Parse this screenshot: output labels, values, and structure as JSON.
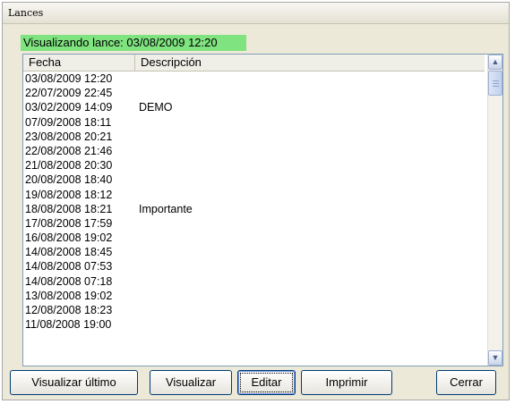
{
  "window": {
    "title": "Lances"
  },
  "status": {
    "text": "Visualizando lance: 03/08/2009 12:20"
  },
  "list": {
    "columns": [
      "Fecha",
      "Descripción"
    ],
    "rows": [
      {
        "date": "03/08/2009 12:20",
        "desc": ""
      },
      {
        "date": "22/07/2009 22:45",
        "desc": ""
      },
      {
        "date": "03/02/2009 14:09",
        "desc": "DEMO"
      },
      {
        "date": "07/09/2008 18:11",
        "desc": ""
      },
      {
        "date": "23/08/2008 20:21",
        "desc": ""
      },
      {
        "date": "22/08/2008 21:46",
        "desc": ""
      },
      {
        "date": "21/08/2008 20:30",
        "desc": ""
      },
      {
        "date": "20/08/2008 18:40",
        "desc": ""
      },
      {
        "date": "19/08/2008 18:12",
        "desc": ""
      },
      {
        "date": "18/08/2008 18:21",
        "desc": "Importante"
      },
      {
        "date": "17/08/2008 17:59",
        "desc": ""
      },
      {
        "date": "16/08/2008 19:02",
        "desc": ""
      },
      {
        "date": "14/08/2008 18:45",
        "desc": ""
      },
      {
        "date": "14/08/2008 07:53",
        "desc": ""
      },
      {
        "date": "14/08/2008 07:18",
        "desc": ""
      },
      {
        "date": "13/08/2008 19:02",
        "desc": ""
      },
      {
        "date": "12/08/2008 18:23",
        "desc": ""
      },
      {
        "date": "11/08/2008 19:00",
        "desc": ""
      }
    ]
  },
  "scrollbar": {
    "up_icon": "chevron-up-icon",
    "down_icon": "chevron-down-icon"
  },
  "buttons": {
    "last": "Visualizar último",
    "view": "Visualizar",
    "edit": "Editar",
    "print": "Imprimir",
    "close": "Cerrar"
  }
}
